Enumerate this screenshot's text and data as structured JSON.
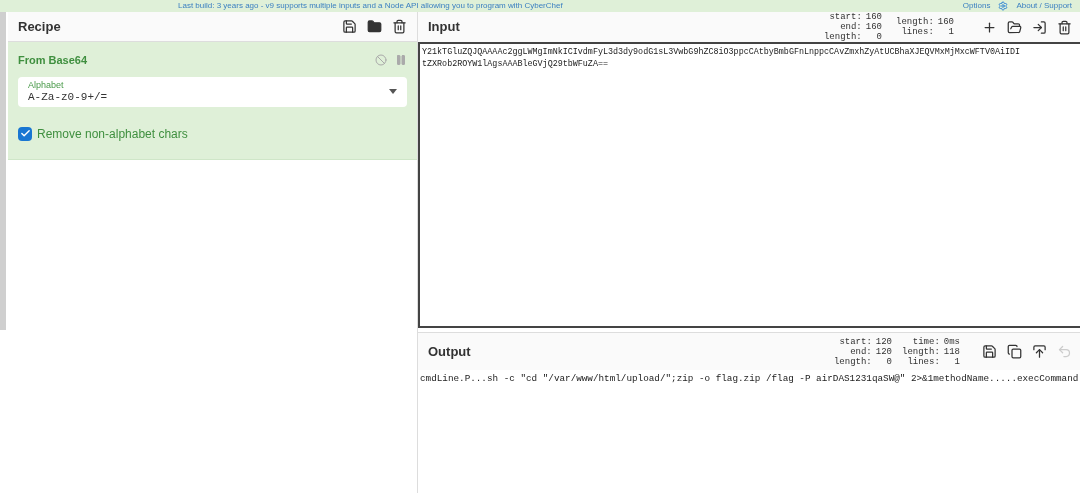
{
  "banner": {
    "message": "Last build: 3 years ago - v9 supports multiple inputs and a Node API allowing you to program with CyberChef",
    "links": [
      "Options",
      "About / Support"
    ]
  },
  "recipe": {
    "title": "Recipe",
    "operations": [
      {
        "name": "From Base64",
        "disabled": false,
        "paused": false,
        "fields": [
          {
            "kind": "select",
            "label": "Alphabet",
            "value": "A-Za-z0-9+/="
          },
          {
            "kind": "checkbox",
            "label": "Remove non-alphabet chars",
            "checked": true
          }
        ]
      }
    ]
  },
  "input": {
    "title": "Input",
    "stats": [
      [
        "start:",
        "160"
      ],
      [
        "end:",
        "160"
      ],
      [
        "length:",
        "0"
      ]
    ],
    "stats2": [
      [
        "length:",
        "160"
      ],
      [
        "lines:",
        "1"
      ]
    ],
    "lines": [
      "Y21kTGluZQJQAAAAc2ggLWMgImNkICIvdmFyL3d3dy9odG1sL3VwbG9hZC8iO3ppcCAtbyBmbGFnLnppcCAvZmxhZyAtUCBhaXJEQVMxMjMxcWFTV0AiIDI",
      "tZXRob2ROYW1lAgsAAABleGVjQ29tbWFuZA=="
    ]
  },
  "output": {
    "title": "Output",
    "stats": [
      [
        "start:",
        "120"
      ],
      [
        "end:",
        "120"
      ],
      [
        "length:",
        "0"
      ]
    ],
    "stats2": [
      [
        "time:",
        "0ms"
      ],
      [
        "length:",
        "118"
      ],
      [
        "lines:",
        "1"
      ]
    ],
    "text": "cmdLine.P...sh -c \"cd \"/var/www/html/upload/\";zip -o flag.zip /flag -P airDAS1231qaSW@\" 2>&1methodName.....execCommand"
  }
}
